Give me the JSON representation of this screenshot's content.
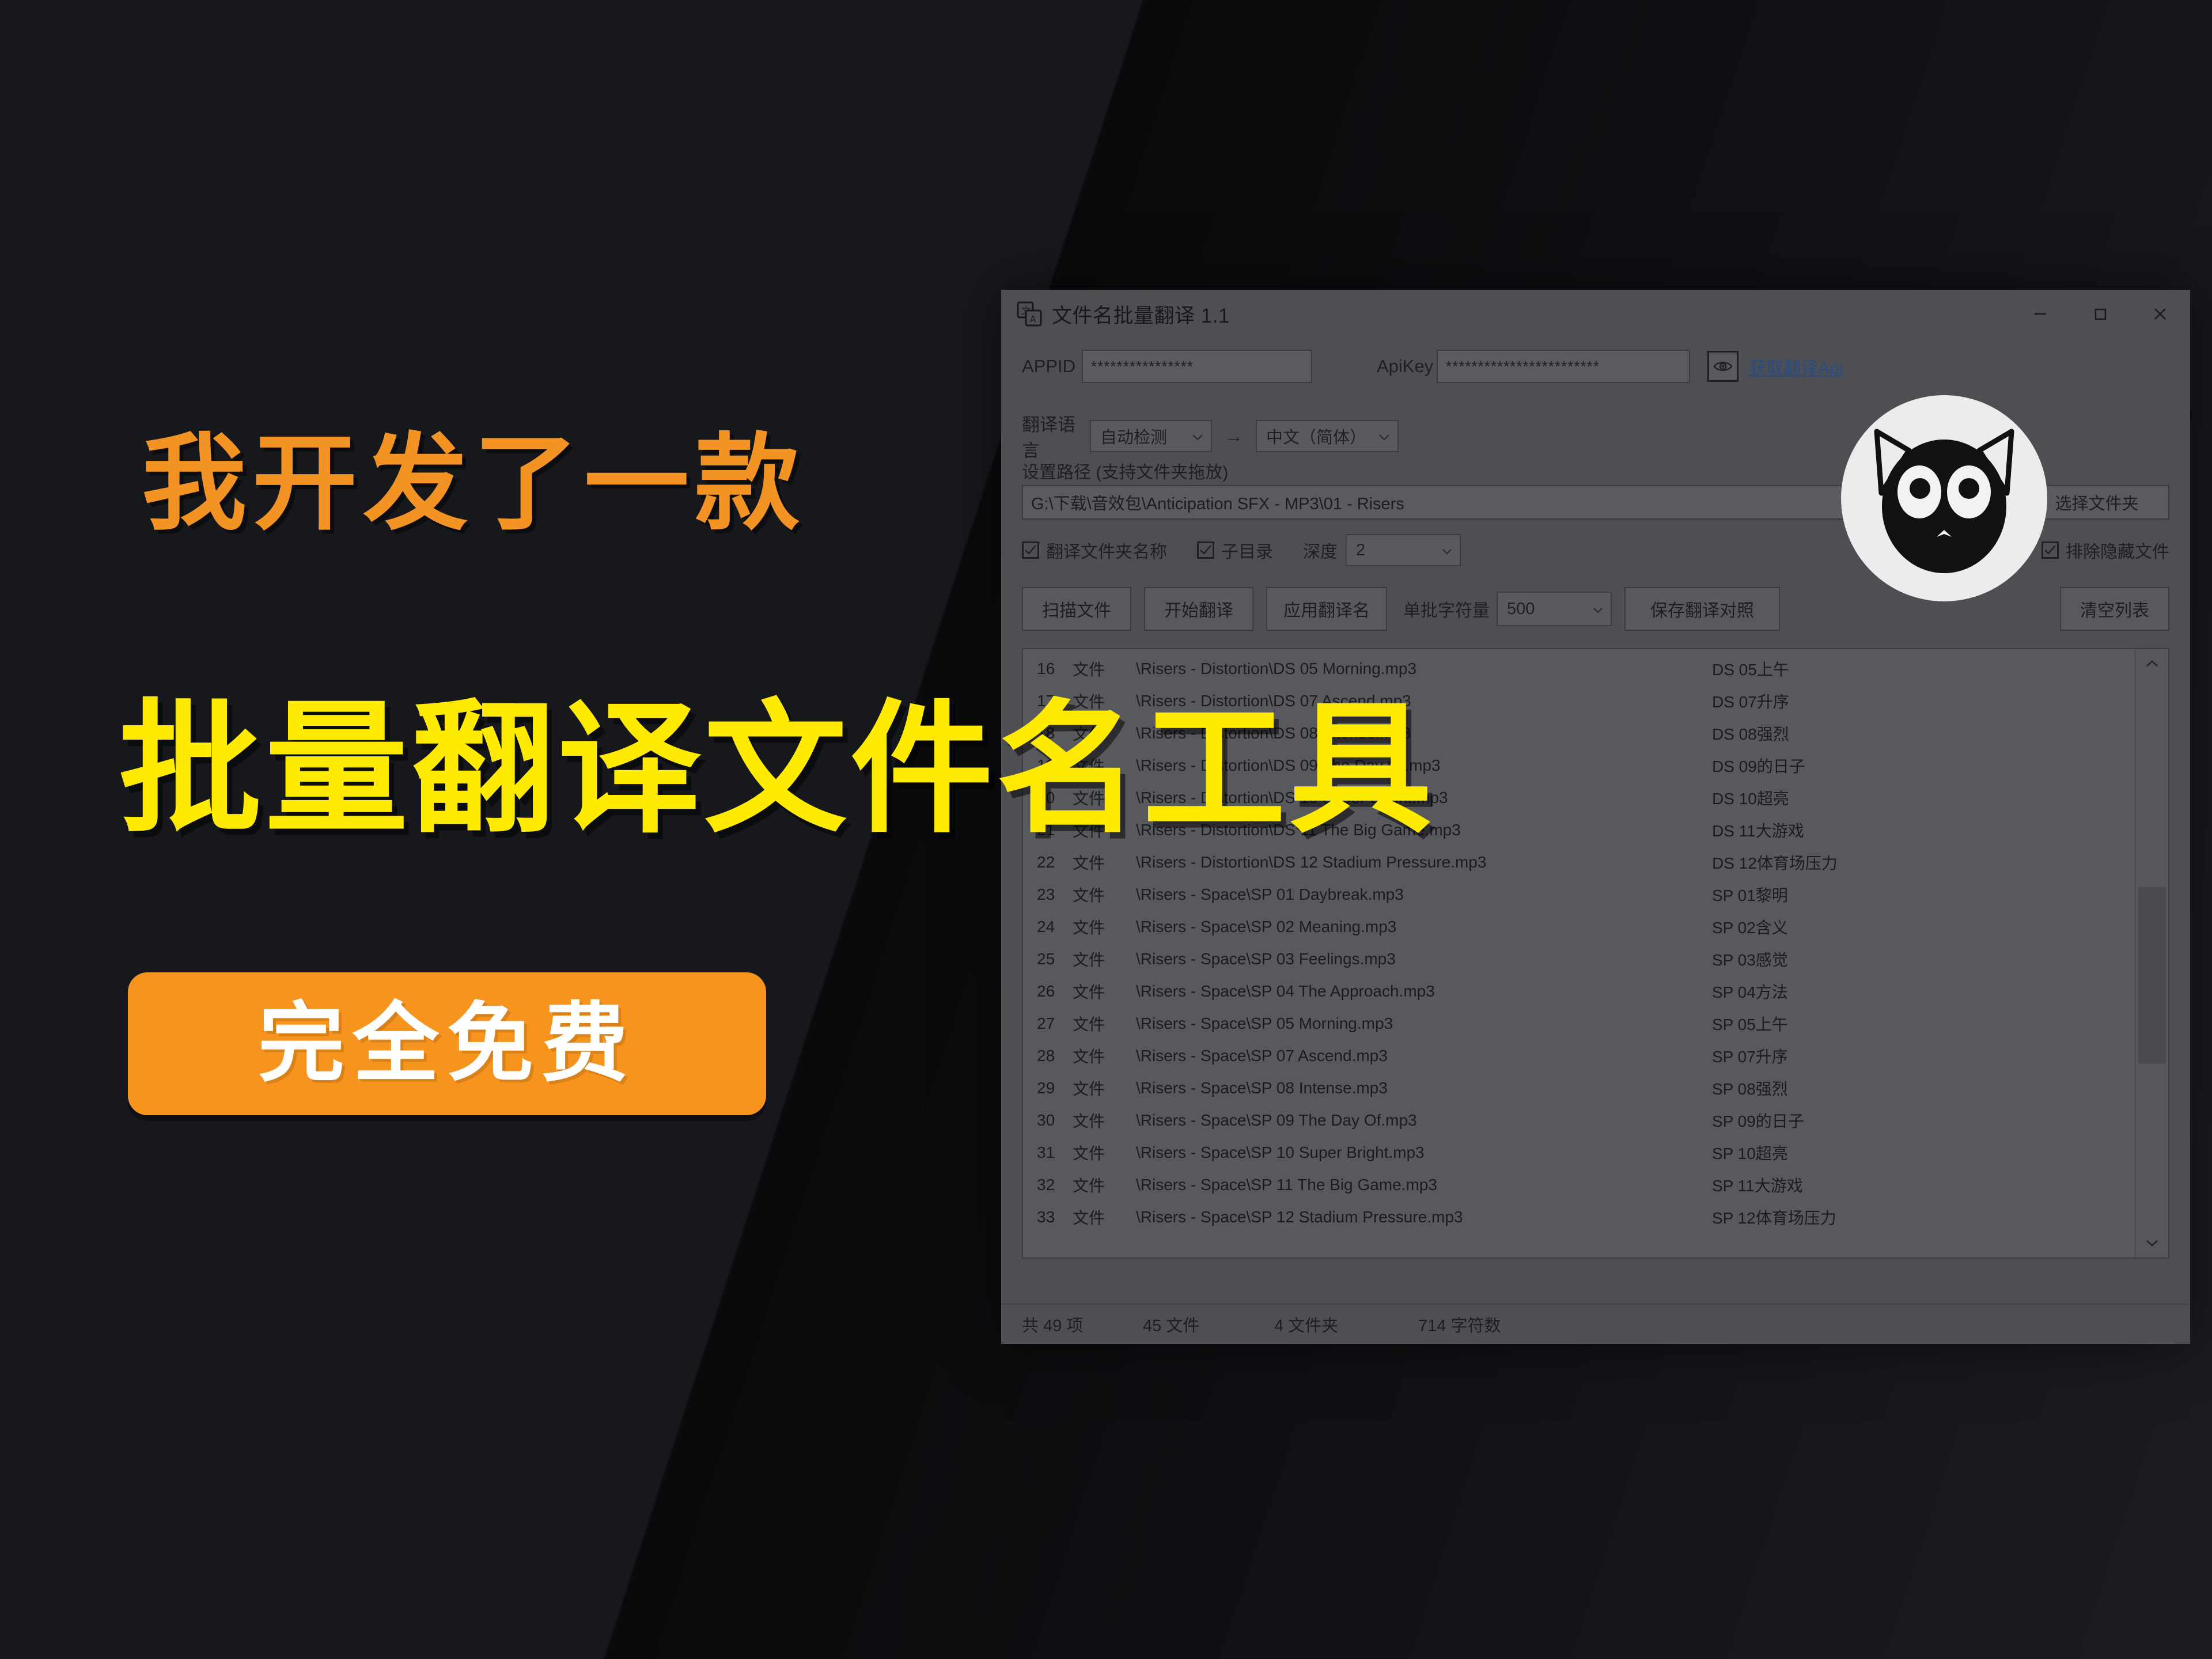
{
  "promo": {
    "headline_orange": "我开发了一款",
    "headline_yellow": "批量翻译文件名工具",
    "badge_text": "完全免费",
    "colors": {
      "orange": "#f29324",
      "yellow": "#ffeb00",
      "badge_bg": "#f7941d",
      "badge_text": "#ffffff",
      "background": "#0b0b0d"
    },
    "logo": "cat-face-logo"
  },
  "window": {
    "title": "文件名批量翻译 1.1",
    "icon": "translate-icon",
    "controls": {
      "minimize": "minimize-icon",
      "maximize": "maximize-icon",
      "close": "close-icon"
    }
  },
  "api": {
    "appid_label": "APPID",
    "appid_value": "****************",
    "apikey_label": "ApiKey",
    "apikey_value": "************************",
    "eye_icon": "eye-icon",
    "link_text": "获取翻译Api",
    "link_color": "#2a4c82"
  },
  "language": {
    "label": "翻译语言",
    "source": "自动检测",
    "arrow": "→",
    "target": "中文（简体）"
  },
  "path": {
    "label": "设置路径 (支持文件夹拖放)",
    "value": "G:\\下载\\音效包\\Anticipation SFX - MP3\\01 - Risers",
    "browse_button": "选择文件夹"
  },
  "options": {
    "translate_folder_names": {
      "label": "翻译文件夹名称",
      "checked": true
    },
    "subdirectory": {
      "label": "子目录",
      "checked": true
    },
    "depth_label": "深度",
    "depth_value": "2",
    "exclude_hidden": {
      "label": "排除隐藏文件",
      "checked": true
    }
  },
  "actions": {
    "scan": "扫描文件",
    "start_translate": "开始翻译",
    "apply_names": "应用翻译名",
    "batch_label": "单批字符量",
    "batch_value": "500",
    "save_compare": "保存翻译对照",
    "clear_list": "清空列表"
  },
  "file_list": [
    {
      "index": "16",
      "type": "文件",
      "path": "\\Risers - Distortion\\DS 05 Morning.mp3",
      "translated": "DS 05上午"
    },
    {
      "index": "17",
      "type": "文件",
      "path": "\\Risers - Distortion\\DS 07 Ascend.mp3",
      "translated": "DS 07升序"
    },
    {
      "index": "18",
      "type": "文件",
      "path": "\\Risers - Distortion\\DS 08 Intense.mp3",
      "translated": "DS 08强烈"
    },
    {
      "index": "19",
      "type": "文件",
      "path": "\\Risers - Distortion\\DS 09 The Day Of.mp3",
      "translated": "DS 09的日子"
    },
    {
      "index": "20",
      "type": "文件",
      "path": "\\Risers - Distortion\\DS 10 Super Bright.mp3",
      "translated": "DS 10超亮"
    },
    {
      "index": "21",
      "type": "文件",
      "path": "\\Risers - Distortion\\DS 11 The Big Game.mp3",
      "translated": "DS 11大游戏"
    },
    {
      "index": "22",
      "type": "文件",
      "path": "\\Risers - Distortion\\DS 12 Stadium Pressure.mp3",
      "translated": "DS 12体育场压力"
    },
    {
      "index": "23",
      "type": "文件",
      "path": "\\Risers - Space\\SP 01 Daybreak.mp3",
      "translated": "SP 01黎明"
    },
    {
      "index": "24",
      "type": "文件",
      "path": "\\Risers - Space\\SP 02 Meaning.mp3",
      "translated": "SP 02含义"
    },
    {
      "index": "25",
      "type": "文件",
      "path": "\\Risers - Space\\SP 03 Feelings.mp3",
      "translated": "SP 03感觉"
    },
    {
      "index": "26",
      "type": "文件",
      "path": "\\Risers - Space\\SP 04 The Approach.mp3",
      "translated": "SP 04方法"
    },
    {
      "index": "27",
      "type": "文件",
      "path": "\\Risers - Space\\SP 05 Morning.mp3",
      "translated": "SP 05上午"
    },
    {
      "index": "28",
      "type": "文件",
      "path": "\\Risers - Space\\SP 07 Ascend.mp3",
      "translated": "SP 07升序"
    },
    {
      "index": "29",
      "type": "文件",
      "path": "\\Risers - Space\\SP 08 Intense.mp3",
      "translated": "SP 08强烈"
    },
    {
      "index": "30",
      "type": "文件",
      "path": "\\Risers - Space\\SP 09 The Day Of.mp3",
      "translated": "SP 09的日子"
    },
    {
      "index": "31",
      "type": "文件",
      "path": "\\Risers - Space\\SP 10 Super Bright.mp3",
      "translated": "SP 10超亮"
    },
    {
      "index": "32",
      "type": "文件",
      "path": "\\Risers - Space\\SP 11 The Big Game.mp3",
      "translated": "SP 11大游戏"
    },
    {
      "index": "33",
      "type": "文件",
      "path": "\\Risers - Space\\SP 12 Stadium Pressure.mp3",
      "translated": "SP 12体育场压力"
    }
  ],
  "status": {
    "total": "共 49 项",
    "files": "45 文件",
    "folders": "4 文件夹",
    "chars": "714 字符数"
  }
}
